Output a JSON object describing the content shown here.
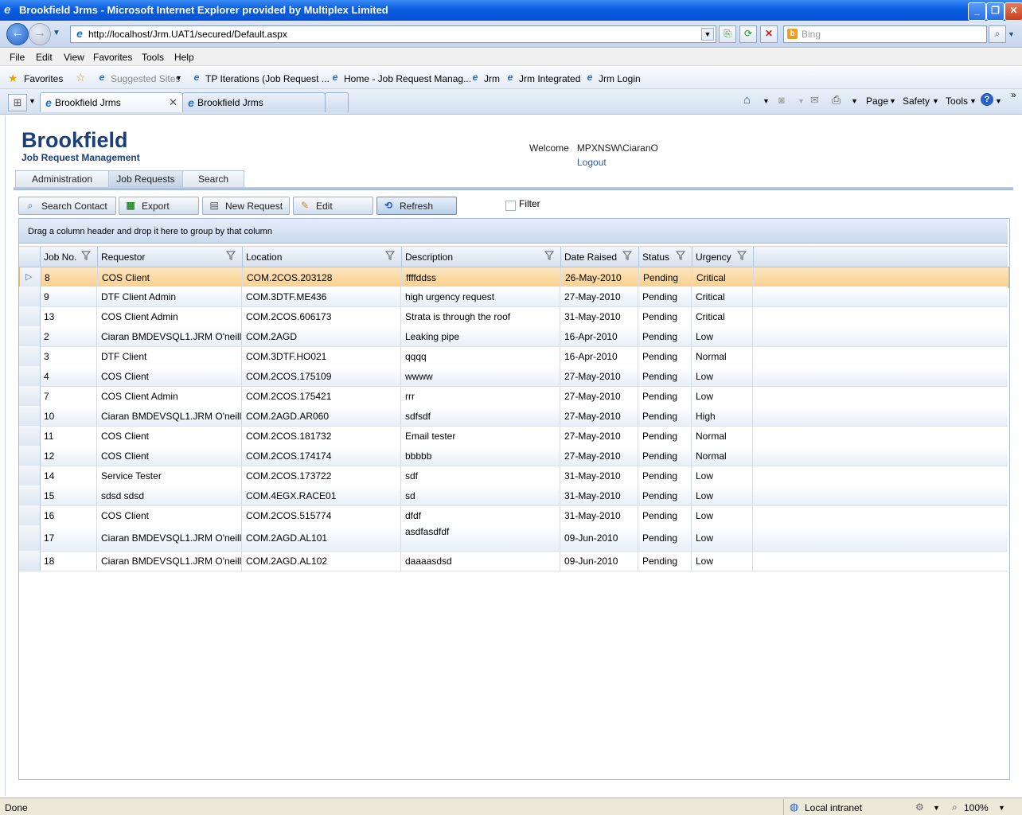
{
  "window": {
    "title": "Brookfield Jrms - Microsoft Internet Explorer provided by Multiplex Limited"
  },
  "address": {
    "url": "http://localhost/Jrm.UAT1/secured/Default.aspx",
    "search_placeholder": "Bing"
  },
  "menu": [
    "File",
    "Edit",
    "View",
    "Favorites",
    "Tools",
    "Help"
  ],
  "favorites": {
    "label": "Favorites",
    "items": [
      "Suggested Sites",
      "TP  Iterations (Job Request ...",
      "Home - Job Request Manag...",
      "Jrm",
      "Jrm Integrated",
      "Jrm Login"
    ]
  },
  "browser_tabs": [
    "Brookfield Jrms",
    "Brookfield Jrms"
  ],
  "command_bar": [
    "Page",
    "Safety",
    "Tools"
  ],
  "app": {
    "logo": "Brookfield",
    "subtitle": "Job Request Management",
    "welcome_label": "Welcome",
    "user": "MPXNSW\\CiaranO",
    "logout": "Logout",
    "tabs": [
      "Administration",
      "Job Requests",
      "Search"
    ],
    "active_tab": "Job Requests",
    "toolbar": [
      "Search Contact",
      "Export",
      "New Request",
      "Edit",
      "Refresh"
    ],
    "filter_label": "Filter"
  },
  "grid": {
    "group_hint": "Drag a column header and drop it here to group by that column",
    "columns": [
      "Job No.",
      "Requestor",
      "Location",
      "Description",
      "Date Raised",
      "Status",
      "Urgency"
    ],
    "rows": [
      [
        "8",
        "COS Client",
        "COM.2COS.203128",
        "ffffddss",
        "26-May-2010",
        "Pending",
        "Critical"
      ],
      [
        "9",
        "DTF Client Admin",
        "COM.3DTF.ME436",
        "high urgency request",
        "27-May-2010",
        "Pending",
        "Critical"
      ],
      [
        "13",
        "COS Client Admin",
        "COM.2COS.606173",
        "Strata is through the roof",
        "31-May-2010",
        "Pending",
        "Critical"
      ],
      [
        "2",
        "Ciaran BMDEVSQL1.JRM O'neill",
        "COM.2AGD",
        "Leaking pipe",
        "16-Apr-2010",
        "Pending",
        "Low"
      ],
      [
        "3",
        "DTF Client",
        "COM.3DTF.HO021",
        "qqqq",
        "16-Apr-2010",
        "Pending",
        "Normal"
      ],
      [
        "4",
        "COS Client",
        "COM.2COS.175109",
        "wwww",
        "27-May-2010",
        "Pending",
        "Low"
      ],
      [
        "7",
        "COS Client Admin",
        "COM.2COS.175421",
        "rrr",
        "27-May-2010",
        "Pending",
        "Low"
      ],
      [
        "10",
        "Ciaran BMDEVSQL1.JRM O'neill",
        "COM.2AGD.AR060",
        "sdfsdf",
        "27-May-2010",
        "Pending",
        "High"
      ],
      [
        "11",
        "COS Client",
        "COM.2COS.181732",
        "Email tester",
        "27-May-2010",
        "Pending",
        "Normal"
      ],
      [
        "12",
        "COS Client",
        "COM.2COS.174174",
        "bbbbb",
        "27-May-2010",
        "Pending",
        "Normal"
      ],
      [
        "14",
        "Service Tester",
        "COM.2COS.173722",
        "sdf",
        "31-May-2010",
        "Pending",
        "Low"
      ],
      [
        "15",
        "sdsd sdsd",
        "COM.4EGX.RACE01",
        "sd",
        "31-May-2010",
        "Pending",
        "Low"
      ],
      [
        "16",
        "COS Client",
        "COM.2COS.515774",
        "dfdf",
        "31-May-2010",
        "Pending",
        "Low"
      ],
      [
        "17",
        "Ciaran BMDEVSQL1.JRM O'neill",
        "COM.2AGD.AL101",
        "asdfasdfdf",
        "09-Jun-2010",
        "Pending",
        "Low"
      ],
      [
        "18",
        "Ciaran BMDEVSQL1.JRM O'neill",
        "COM.2AGD.AL102",
        "daaaasdsd",
        "09-Jun-2010",
        "Pending",
        "Low"
      ]
    ]
  },
  "status": {
    "left": "Done",
    "zone": "Local intranet",
    "zoom": "100%"
  },
  "colors": {
    "brand": "#1c3f78",
    "selected_row": "#f9cf8c",
    "title_bar": "#0a5ee0"
  }
}
